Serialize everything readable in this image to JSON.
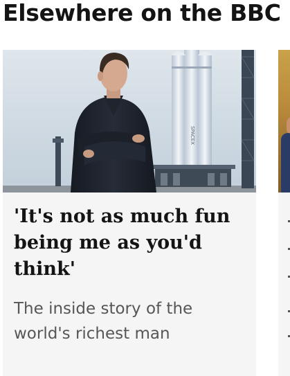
{
  "section": {
    "title": "Elsewhere on the BBC"
  },
  "cards": [
    {
      "headline": "'It's not as much fun being me as you'd think'",
      "summary": "The inside story of the world's richest man",
      "image_alt": "Man with arms crossed standing in front of a rocket on a launch pad",
      "rocket_label": "SPACEX"
    }
  ],
  "colors": {
    "page_background": "#ffffff",
    "card_background": "#f5f5f5",
    "headline_text": "#141414",
    "summary_text": "#545658"
  }
}
